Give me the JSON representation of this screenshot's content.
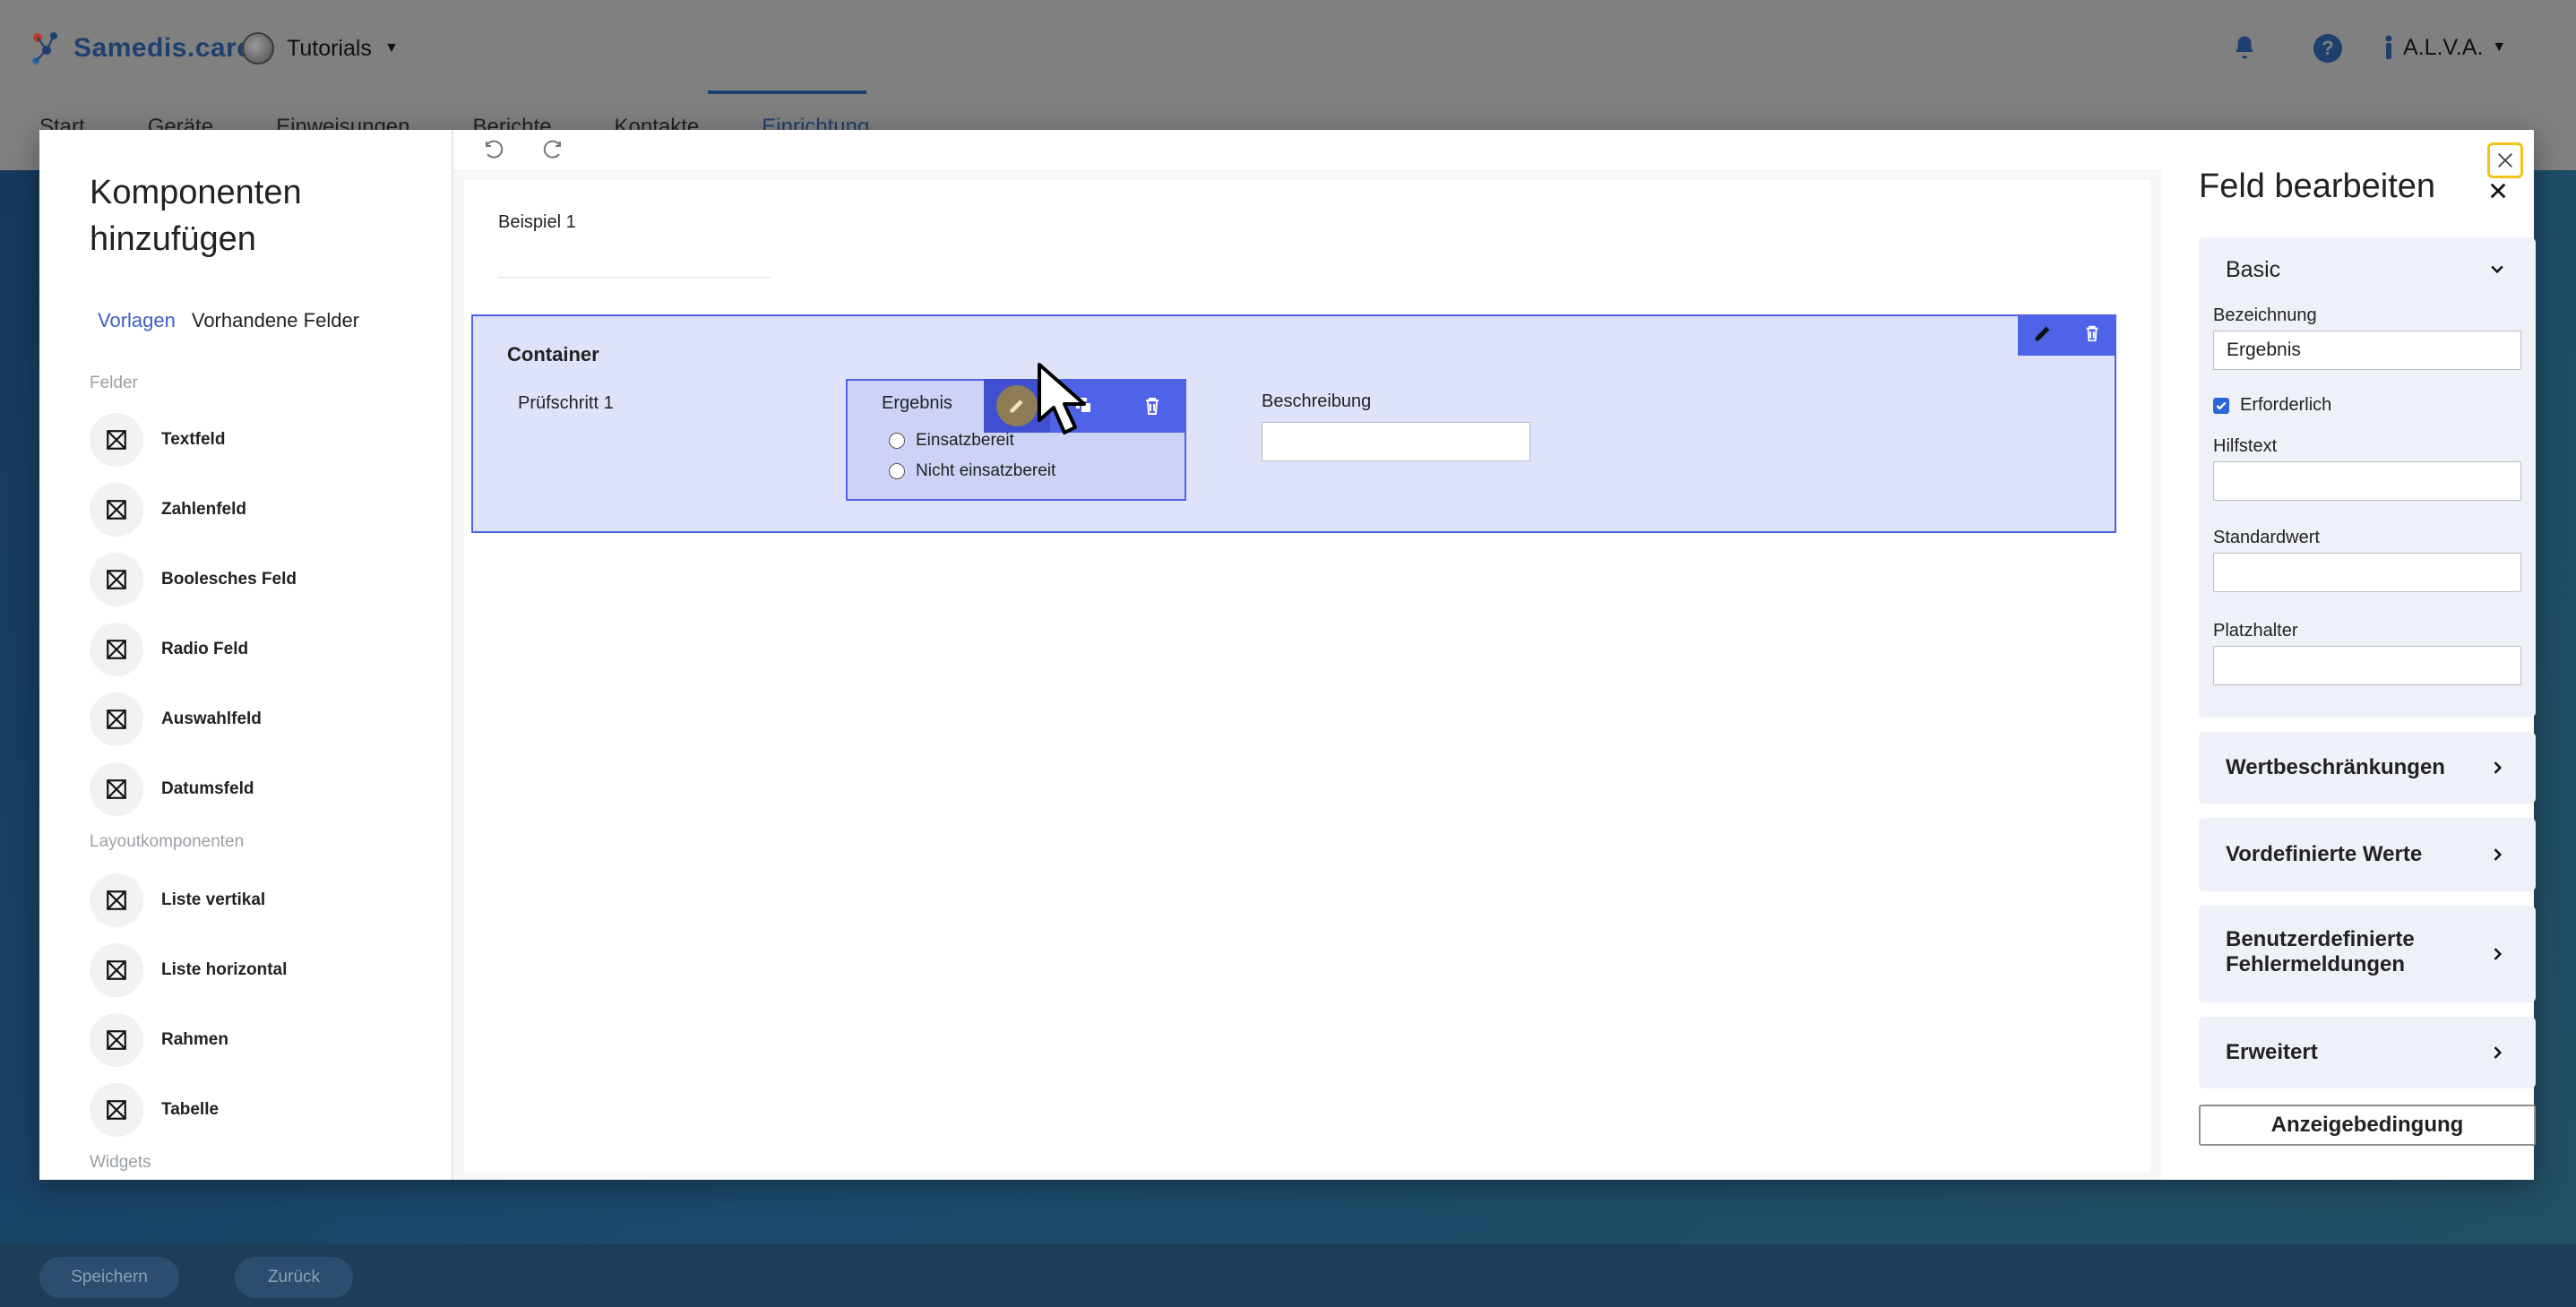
{
  "header": {
    "brand": "Samedis.care",
    "tenant": "Tutorials",
    "user": "A.L.V.A.",
    "help_symbol": "?",
    "nav": [
      "Start",
      "Geräte",
      "Einweisungen",
      "Berichte",
      "Kontakte",
      "Einrichtung"
    ],
    "active_nav": "Einrichtung"
  },
  "footer": {
    "save": "Speichern",
    "back": "Zurück"
  },
  "left": {
    "title": "Komponenten hinzufügen",
    "tabs": {
      "templates": "Vorlagen",
      "existing": "Vorhandene Felder"
    },
    "groups": {
      "fields": "Felder",
      "layout": "Layoutkomponenten",
      "widgets": "Widgets"
    },
    "field_items": [
      "Textfeld",
      "Zahlenfeld",
      "Boolesches Feld",
      "Radio Feld",
      "Auswahlfeld",
      "Datumsfeld"
    ],
    "layout_items": [
      "Liste vertikal",
      "Liste horizontal",
      "Rahmen",
      "Tabelle"
    ]
  },
  "canvas": {
    "example": "Beispiel 1",
    "container_title": "Container",
    "step": "Prüfschritt 1",
    "radio_field_label": "Ergebnis",
    "radio_options": [
      "Einsatzbereit",
      "Nicht einsatzbereit"
    ],
    "description_label": "Beschreibung"
  },
  "right": {
    "title": "Feld bearbeiten",
    "basic_section": "Basic",
    "label_field": {
      "label": "Bezeichnung",
      "value": "Ergebnis"
    },
    "required": {
      "label": "Erforderlich",
      "checked": true
    },
    "help_text": {
      "label": "Hilfstext",
      "value": ""
    },
    "default_value": {
      "label": "Standardwert",
      "value": ""
    },
    "placeholder": {
      "label": "Platzhalter",
      "value": ""
    },
    "accordions": [
      "Wertbeschränkungen",
      "Vordefinierte Werte",
      "Benutzerdefinierte Fehlermeldungen",
      "Erweitert"
    ],
    "condition_button": "Anzeigebedingung"
  },
  "colors": {
    "primary": "#4e63e8",
    "container_bg": "#dfe3fa",
    "brand": "#1f3f6e",
    "link": "#3a5ec8",
    "close_highlight": "#f0c419"
  }
}
